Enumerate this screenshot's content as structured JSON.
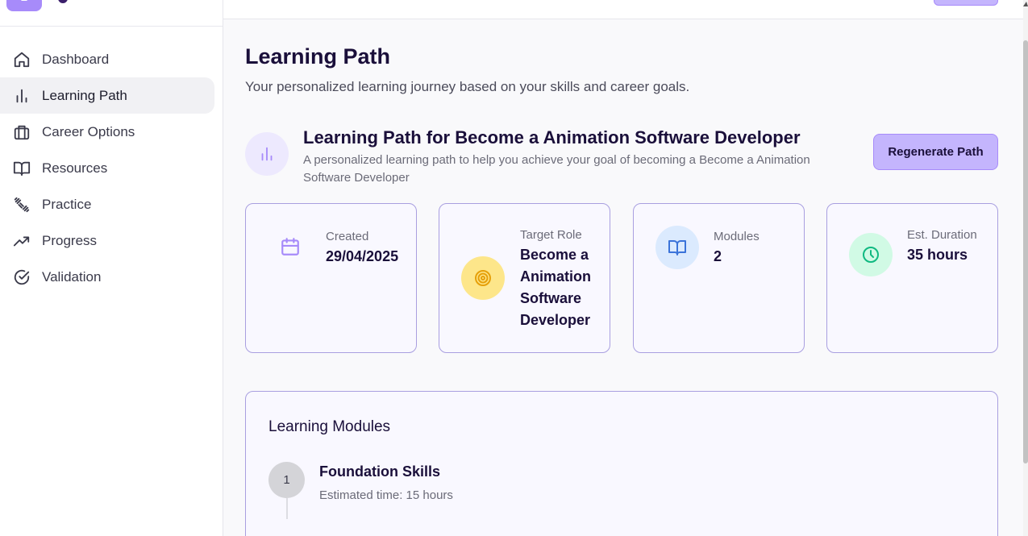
{
  "sidebar": {
    "items": [
      {
        "label": "Dashboard",
        "icon": "home-icon"
      },
      {
        "label": "Learning Path",
        "icon": "bar-chart-icon",
        "active": true
      },
      {
        "label": "Career Options",
        "icon": "briefcase-icon"
      },
      {
        "label": "Resources",
        "icon": "book-open-icon"
      },
      {
        "label": "Practice",
        "icon": "dumbbell-icon"
      },
      {
        "label": "Progress",
        "icon": "trending-up-icon"
      },
      {
        "label": "Validation",
        "icon": "check-circle-icon"
      }
    ]
  },
  "main": {
    "title": "Learning Path",
    "subtitle": "Your personalized learning journey based on your skills and career goals.",
    "path": {
      "title": "Learning Path for Become a Animation Software Developer",
      "description": "A personalized learning path to help you achieve your goal of becoming a Become a Animation Software Developer",
      "regenerate_label": "Regenerate Path"
    },
    "stats": {
      "created": {
        "label": "Created",
        "value": "29/04/2025"
      },
      "target_role": {
        "label": "Target Role",
        "value": "Become a Animation Software Developer"
      },
      "modules": {
        "label": "Modules",
        "value": "2"
      },
      "duration": {
        "label": "Est. Duration",
        "value": "35 hours"
      }
    },
    "modules_section": {
      "title": "Learning Modules",
      "items": [
        {
          "number": "1",
          "title": "Foundation Skills",
          "time": "Estimated time: 15 hours"
        }
      ]
    }
  },
  "colors": {
    "accent": "#a78bfa",
    "accent_light": "#c4b5fd",
    "heading": "#1a0f3a",
    "target_icon_bg": "#fde68a",
    "modules_icon_bg": "#dbeafe",
    "duration_icon_bg": "#d1fae5"
  }
}
